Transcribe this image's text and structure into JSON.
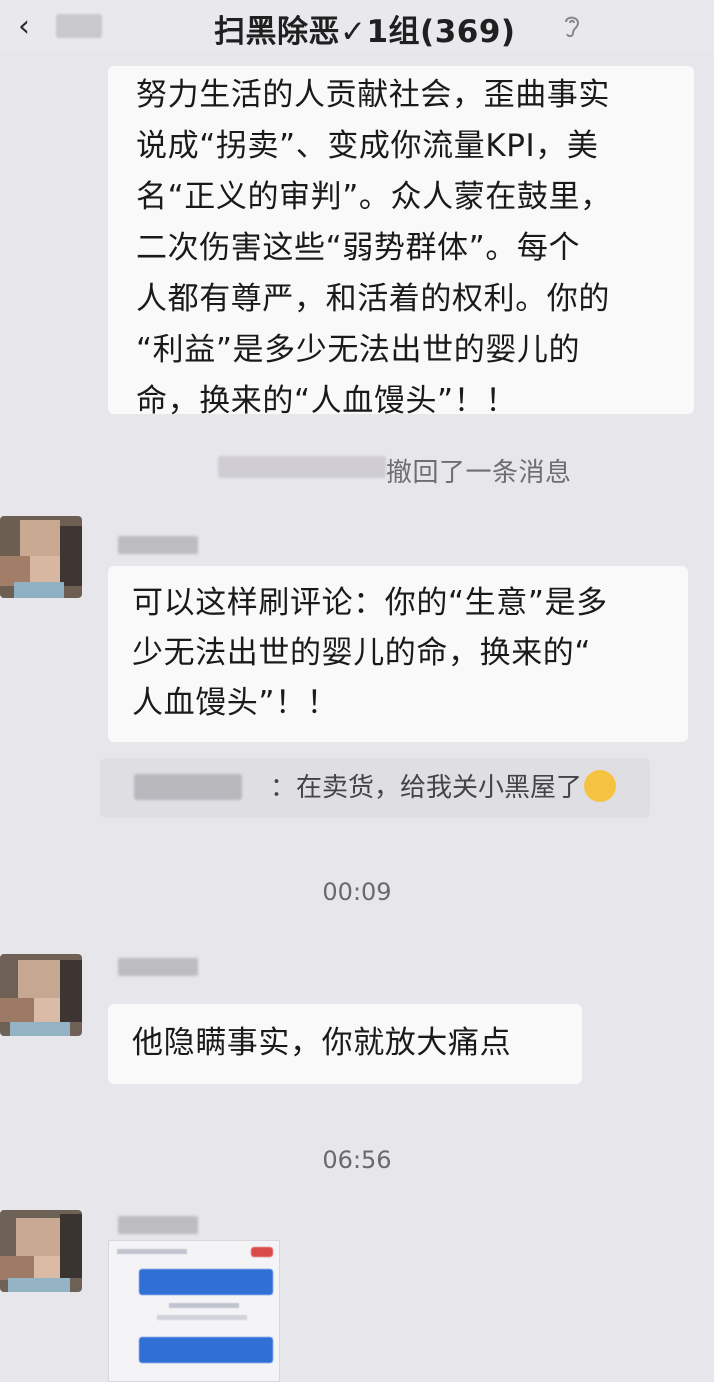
{
  "header": {
    "title": "扫黑除恶✓1组(369)"
  },
  "messages": {
    "m1_text": "努力生活的人贡献社会，歪曲事实\n说成“拐卖”、变成你流量KPI，美\n名“正义的审判”。众人蒙在鼓里，\n二次伤害这些“弱势群体”。每个\n人都有尊严，和活着的权利。你的\n“利益”是多少无法出世的婴儿的\n命，换来的“人血馒头”！！",
    "recall_text": "撤回了一条消息",
    "m2_text": "可以这样刷评论：你的“生意”是多\n少无法出世的婴儿的命，换来的“\n人血馒头”！！",
    "m2_quote": "：在卖货，给我关小黑屋了",
    "time1": "00:09",
    "m3_text": "他隐瞒事实，你就放大痛点",
    "time2": "06:56"
  },
  "colors": {
    "background": "#e7e6ea",
    "bubble": "#f9f9fa",
    "quote_bg": "#dfdee3"
  }
}
